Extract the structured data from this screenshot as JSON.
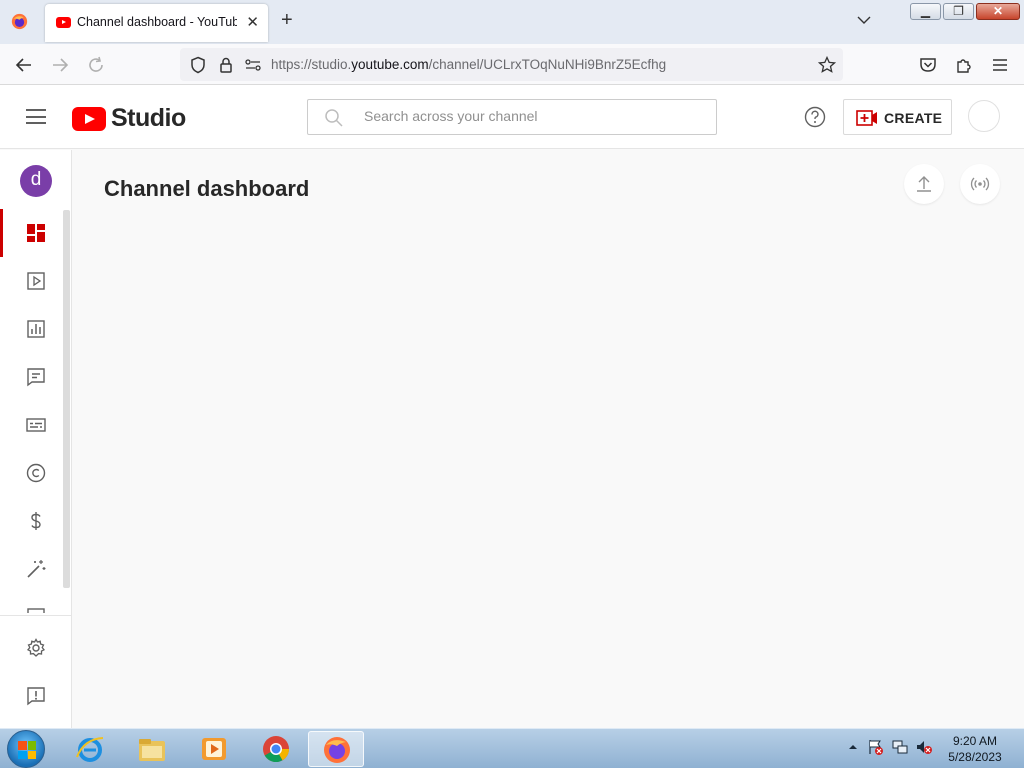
{
  "browser": {
    "tab_title": "Channel dashboard - YouTube",
    "tab_close": "✕",
    "new_tab": "+",
    "url_prefix": "https://studio.",
    "url_domain": "youtube.com",
    "url_path": "/channel/UCLrxTOqNuNHi9BnrZ5Ecfhg"
  },
  "studio": {
    "logo_text": "Studio",
    "search_placeholder": "Search across your channel",
    "create_label": "CREATE",
    "channel_initial": "d",
    "page_title": "Channel dashboard"
  },
  "sidebar": {
    "items": [
      {
        "name": "dashboard",
        "icon": "dashboard-icon",
        "active": true
      },
      {
        "name": "content",
        "icon": "content-icon"
      },
      {
        "name": "analytics",
        "icon": "analytics-icon"
      },
      {
        "name": "comments",
        "icon": "comments-icon"
      },
      {
        "name": "subtitles",
        "icon": "subtitles-icon"
      },
      {
        "name": "copyright",
        "icon": "copyright-icon"
      },
      {
        "name": "earn",
        "icon": "dollar-icon"
      },
      {
        "name": "customization",
        "icon": "magic-wand-icon"
      },
      {
        "name": "audio-library",
        "icon": "audio-library-icon"
      }
    ],
    "bottom": [
      {
        "name": "settings",
        "icon": "gear-icon"
      },
      {
        "name": "send-feedback",
        "icon": "feedback-icon"
      }
    ]
  },
  "taskbar": {
    "apps": [
      "internet-explorer",
      "file-explorer",
      "media-player",
      "chrome",
      "firefox"
    ],
    "active_app": "firefox",
    "time": "9:20 AM",
    "date": "5/28/2023"
  },
  "colors": {
    "brand_red": "#ff0000",
    "active_red": "#cc0000",
    "avatar_purple": "#7a3ea8"
  }
}
